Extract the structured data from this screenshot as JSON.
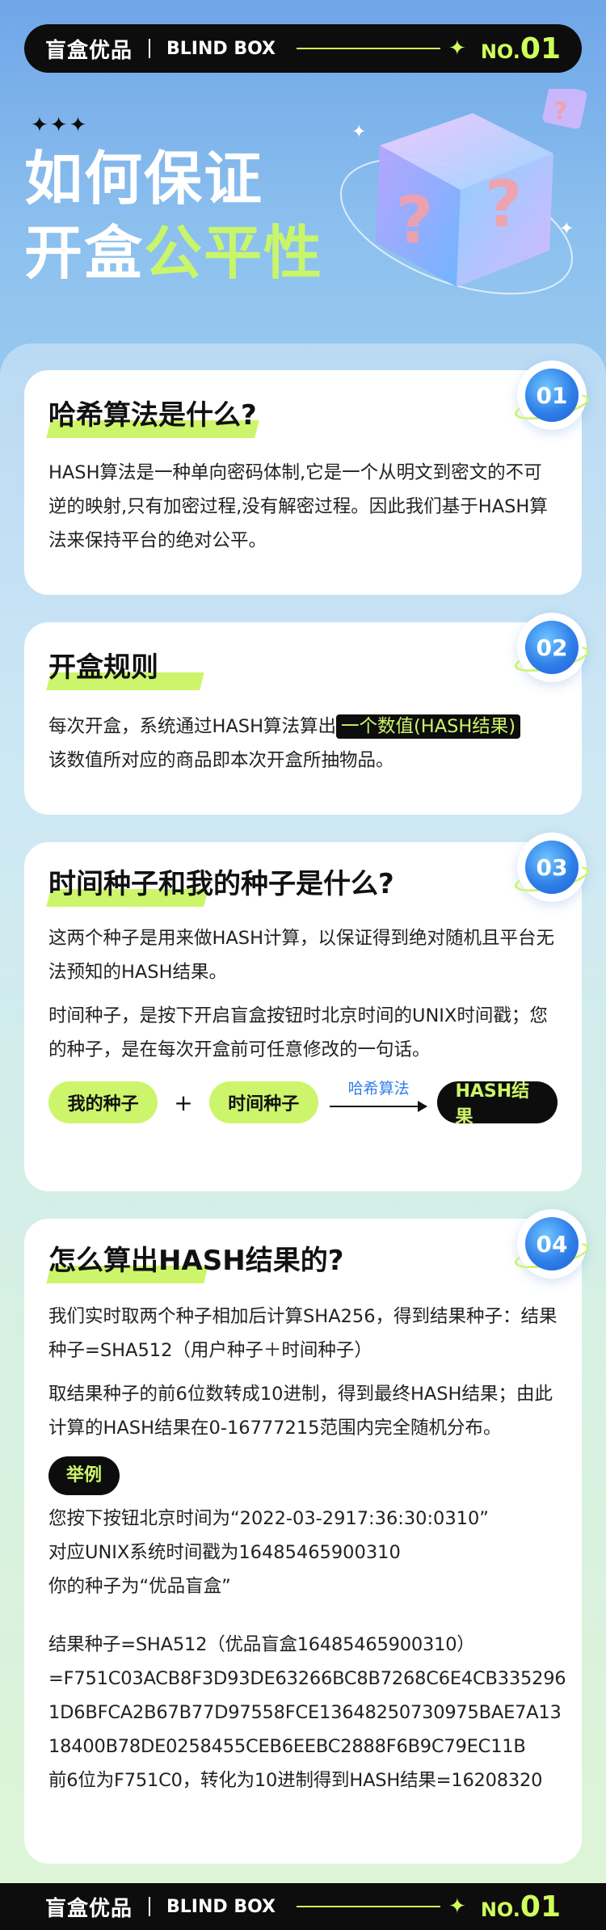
{
  "brand": {
    "name_cn": "盲盒优品",
    "name_en": "BLIND BOX",
    "no_prefix": "NO.",
    "no_number": "01",
    "star": "✦"
  },
  "hero": {
    "stars": "✦✦✦",
    "title_line1": "如何保证",
    "title_line2_plain": "开盒",
    "title_line2_highlight": "公平性"
  },
  "colors": {
    "accent_green": "#cdf56b",
    "black": "#0d0d0d",
    "blue": "#2f7fe8"
  },
  "sections": [
    {
      "badge": "01",
      "title": "哈希算法是什么?",
      "paragraphs": [
        "HASH算法是一种单向密码体制,它是一个从明文到密文的不可逆的映射,只有加密过程,没有解密过程。因此我们基于HASH算法来保持平台的绝对公平。"
      ]
    },
    {
      "badge": "02",
      "title": "开盒规则",
      "text_before": " 每次开盒，系统通过HASH算法算出",
      "highlight": "一个数值(HASH结果)",
      "text_after": "该数值所对应的商品即本次开盒所抽物品。"
    },
    {
      "badge": "03",
      "title": "时间种子和我的种子是什么?",
      "paragraphs": [
        "这两个种子是用来做HASH计算，以保证得到绝对随机且平台无法预知的HASH结果。",
        "时间种子，是按下开启盲盒按钮时北京时间的UNIX时间戳；您的种子，是在每次开盒前可任意修改的一句话。"
      ],
      "flow": {
        "pill1": "我的种子",
        "plus": "+",
        "pill2": "时间种子",
        "arrow_label": "哈希算法",
        "result": "HASH结果"
      }
    },
    {
      "badge": "04",
      "title": "怎么算出HASH结果的?",
      "paragraphs": [
        "我们实时取两个种子相加后计算SHA256，得到结果种子：结果种子=SHA512（用户种子＋时间种子）",
        "取结果种子的前6位数转成10进制，得到最终HASH结果；由此计算的HASH结果在0-16777215范围内完全随机分布。"
      ],
      "example_tag": "举例",
      "example_lines": [
        "您按下按钮北京时间为“2022-03-2917:36:30:0310”",
        "对应UNIX系统时间戳为16485465900310",
        "你的种子为“优品盲盒”"
      ],
      "result_lines": [
        "结果种子=SHA512（优品盲盒16485465900310）",
        "=F751C03ACB8F3D93DE63266BC8B7268C6E4CB335296",
        "1D6BFCA2B67B77D97558FCE13648250730975BAE7A13",
        "18400B78DE0258455CEB6EEBC2888F6B9C79EC11B",
        "前6位为F751C0，转化为10进制得到HASH结果=16208320"
      ]
    }
  ]
}
